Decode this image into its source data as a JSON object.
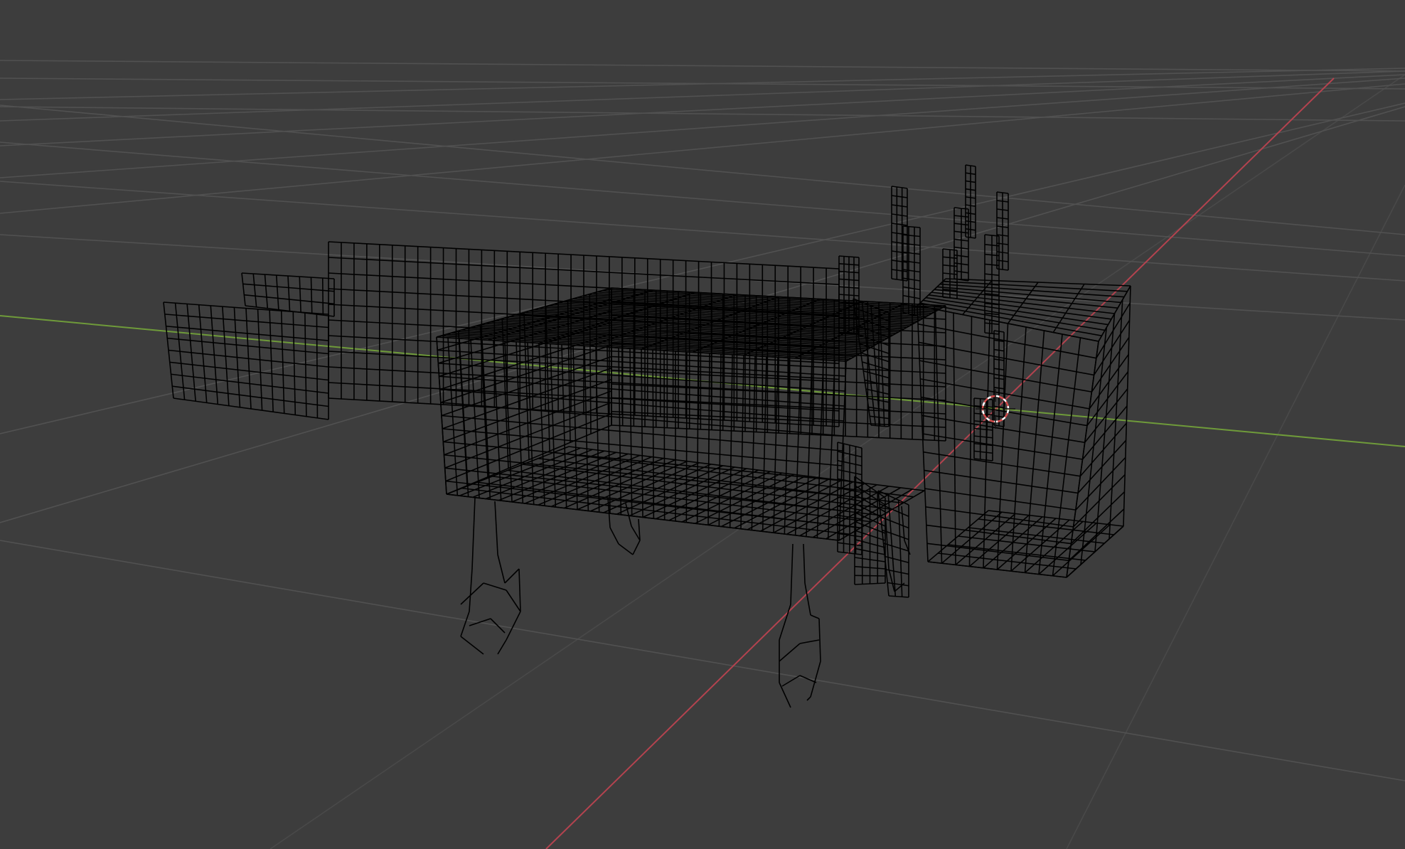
{
  "app": {
    "name": "3D Viewport",
    "view": "perspective",
    "shading": "wireframe"
  },
  "colors": {
    "background": "#3d3d3d",
    "grid_line": "#555555",
    "axis_x": "#b4434f",
    "axis_y": "#6f9b3a",
    "wire": "#000000",
    "cursor_red": "#d24a4a",
    "cursor_white": "#ffffff"
  },
  "scene": {
    "object_type": "mesh",
    "object_shape": "axolotl",
    "parts": [
      "tail",
      "body",
      "head",
      "gills",
      "legs"
    ],
    "cursor": "3d-cursor"
  }
}
